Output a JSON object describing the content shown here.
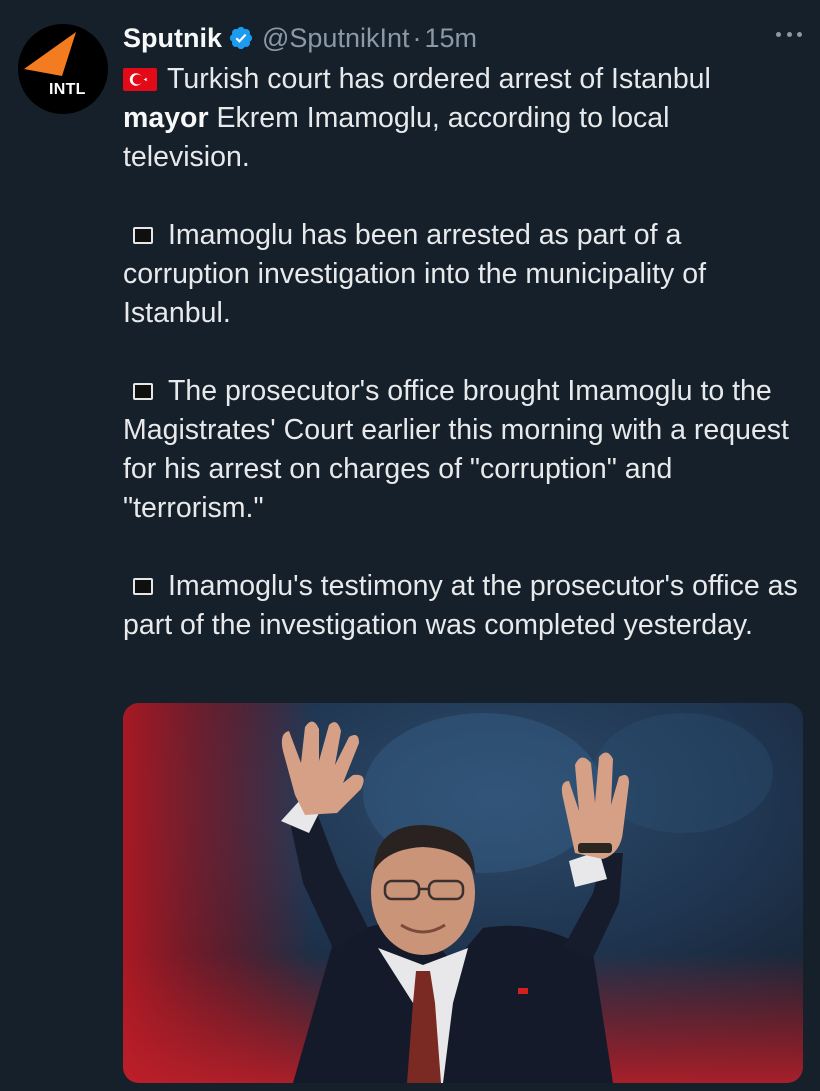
{
  "tweet": {
    "display_name": "Sputnik",
    "handle": "@SputnikInt",
    "separator": "·",
    "time": "15m",
    "avatar_label": "INTL",
    "icons": {
      "verified": "verified-badge-icon",
      "more": "more-options-icon",
      "flag": "turkey-flag-icon",
      "bullet": "black-square-bullet-icon"
    },
    "text": {
      "p1_before": "Turkish court has ordered arrest of Istanbul",
      "p1_bold": "mayor",
      "p1_after": " Ekrem Imamoglu, according to local television.",
      "p2": "Imamoglu has been arrested as part of a corruption investigation into the municipality of Istanbul.",
      "p3": "The prosecutor's office brought Imamoglu to the Magistrates' Court earlier this morning with a request for his arrest on charges of \"corruption\" and \"terrorism.\"",
      "p4": "Imamoglu's testimony at the prosecutor's office as part of the investigation was completed yesterday."
    },
    "colors": {
      "background": "#15202b",
      "text": "#e7e9ea",
      "secondary": "#8b98a5",
      "verified": "#1d9bf0",
      "brand_orange": "#f47c20"
    }
  }
}
